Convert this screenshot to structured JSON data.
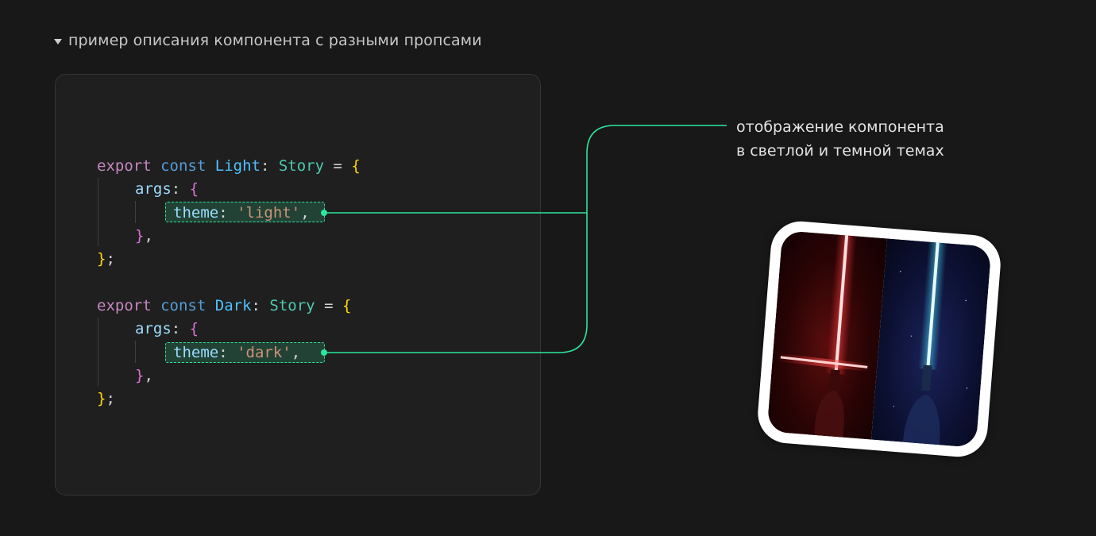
{
  "section": {
    "toggle_icon": "triangle-down-icon",
    "title": "пример описания компонента с разными пропсами"
  },
  "code": {
    "light": {
      "kw_export": "export",
      "kw_const": "const",
      "name": "Light",
      "colon": ":",
      "type": "Story",
      "eq": "=",
      "open": "{",
      "args_key": "args",
      "args_colon": ":",
      "args_open": "{",
      "prop_key": "theme",
      "prop_colon": ":",
      "prop_value": "'light'",
      "prop_comma": ",",
      "args_close": "}",
      "args_comma": ",",
      "close": "}",
      "semi": ";"
    },
    "dark": {
      "kw_export": "export",
      "kw_const": "const",
      "name": "Dark",
      "colon": ":",
      "type": "Story",
      "eq": "=",
      "open": "{",
      "args_key": "args",
      "args_colon": ":",
      "args_open": "{",
      "prop_key": "theme",
      "prop_colon": ":",
      "prop_value": "'dark'",
      "prop_comma": ",",
      "args_close": "}",
      "args_comma": ",",
      "close": "}",
      "semi": ";"
    }
  },
  "annotation": {
    "line1": "отображение компонента",
    "line2": "в светлой и темной темах"
  },
  "colors": {
    "accent": "#2ee59d",
    "background": "#181818",
    "panel": "#1f1f1f"
  }
}
